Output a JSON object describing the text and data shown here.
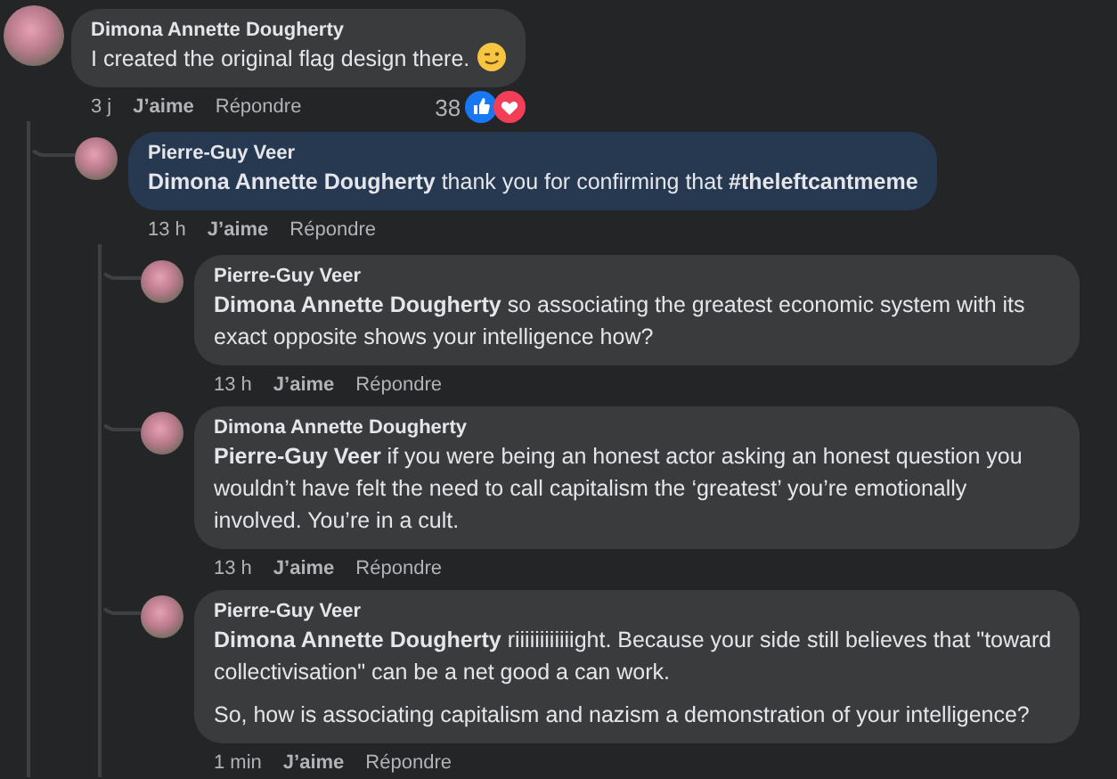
{
  "comments": [
    {
      "author": "Dimona Annette Dougherty",
      "paragraphs": [
        "I created the original flag design there."
      ],
      "highlighted": false,
      "time": "3 j",
      "like": "J’aime",
      "reply": "Répondre",
      "reaction_count": "38",
      "replies": [
        {
          "author": "Pierre-Guy Veer",
          "paragraphs": [
            "**Dimona Annette Dougherty** thank you for confirming that **#theleftcantmeme**"
          ],
          "highlighted": true,
          "time": "13 h",
          "like": "J’aime",
          "reply": "Répondre",
          "replies": [
            {
              "author": "Pierre-Guy Veer",
              "paragraphs": [
                "**Dimona Annette Dougherty** so associating the greatest economic system with its exact opposite shows your intelligence how?"
              ],
              "highlighted": false,
              "time": "13 h",
              "like": "J’aime",
              "reply": "Répondre"
            },
            {
              "author": "Dimona Annette Dougherty",
              "paragraphs": [
                "**Pierre-Guy Veer** if you were being an honest actor asking an honest question you wouldn’t have felt the need to call capitalism the ‘greatest’ you’re emotionally involved. You’re in a cult."
              ],
              "highlighted": false,
              "time": "13 h",
              "like": "J’aime",
              "reply": "Répondre"
            },
            {
              "author": "Pierre-Guy Veer",
              "paragraphs": [
                "**Dimona Annette Dougherty** riiiiiiiiiiiight. Because your side still believes that \"toward collectivisation\" can be a net good a can work.",
                "So, how is associating capitalism and nazism a demonstration of your intelligence?"
              ],
              "highlighted": false,
              "time": "1 min",
              "like": "J’aime",
              "reply": "Répondre"
            }
          ]
        }
      ]
    }
  ]
}
